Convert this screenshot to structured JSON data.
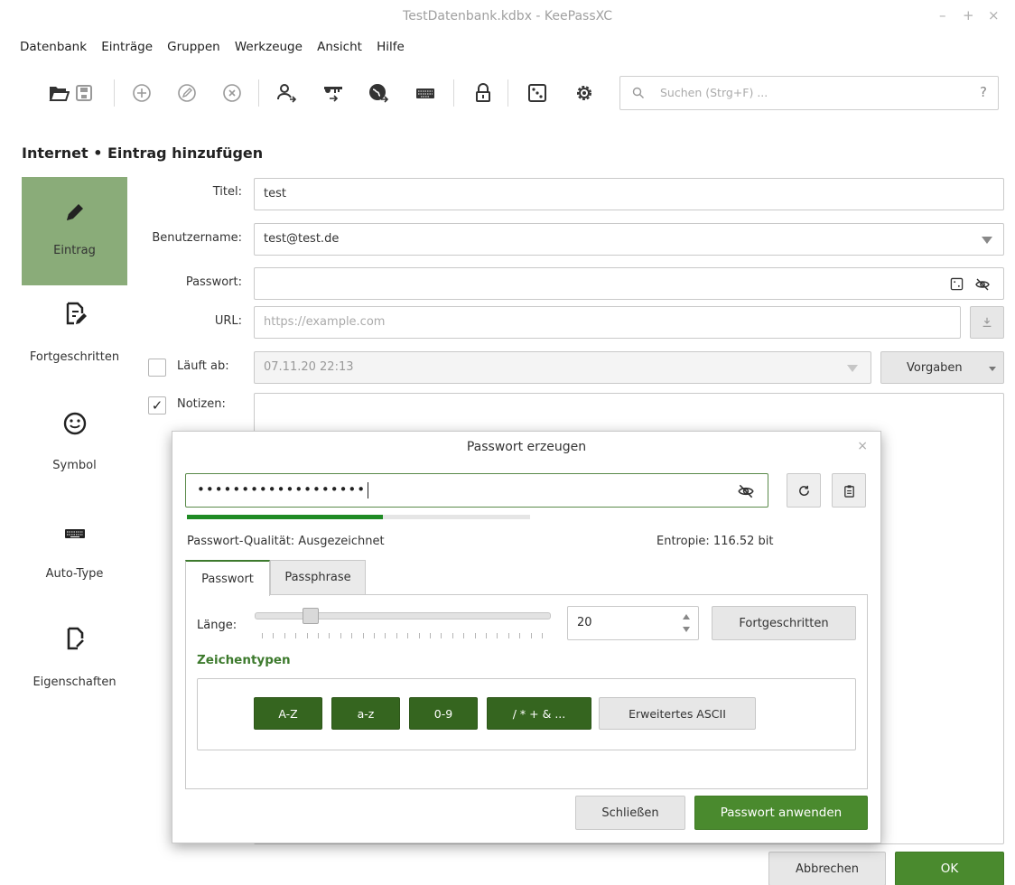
{
  "window": {
    "title": "TestDatenbank.kdbx - KeePassXC",
    "minimize": "–",
    "maximize": "+",
    "close": "×"
  },
  "menu": [
    "Datenbank",
    "Einträge",
    "Gruppen",
    "Werkzeuge",
    "Ansicht",
    "Hilfe"
  ],
  "toolbar": {
    "icons": [
      "open-database-icon",
      "save-database-icon",
      "add-entry-icon",
      "edit-entry-icon",
      "delete-entry-icon",
      "copy-username-icon",
      "copy-password-icon",
      "open-url-icon",
      "auto-type-icon",
      "lock-database-icon",
      "password-generator-icon",
      "settings-icon"
    ],
    "search_placeholder": "Suchen (Strg+F) ...",
    "search_help": "?"
  },
  "heading": "Internet • Eintrag hinzufügen",
  "sidebar": {
    "items": [
      {
        "label": "Eintrag",
        "icon": "pencil-icon",
        "active": true
      },
      {
        "label": "Fortgeschritten",
        "icon": "document-edit-icon",
        "active": false
      },
      {
        "label": "Symbol",
        "icon": "smiley-icon",
        "active": false
      },
      {
        "label": "Auto-Type",
        "icon": "keyboard-icon",
        "active": false
      },
      {
        "label": "Eigenschaften",
        "icon": "document-arrow-icon",
        "active": false
      }
    ]
  },
  "form": {
    "title_label": "Titel:",
    "title_value": "test",
    "username_label": "Benutzername:",
    "username_value": "test@test.de",
    "password_label": "Passwort:",
    "password_value": "",
    "url_label": "URL:",
    "url_placeholder": "https://example.com",
    "expires_label": "Läuft ab:",
    "expires_checked": false,
    "expires_value": "07.11.20 22:13",
    "presets_label": "Vorgaben",
    "notes_label": "Notizen:",
    "notes_checked": true,
    "notes_check_mark": "✓"
  },
  "generator": {
    "title": "Passwort erzeugen",
    "close": "×",
    "password_dots": "•••••••••••••••••••",
    "strength_fraction": 0.57,
    "quality_label": "Passwort-Qualität: Ausgezeichnet",
    "entropy_label": "Entropie: 116.52 bit",
    "tabs": [
      {
        "label": "Passwort",
        "active": true
      },
      {
        "label": "Passphrase",
        "active": false
      }
    ],
    "length_label": "Länge:",
    "length_value": "20",
    "length_slider_fraction": 0.17,
    "advanced_label": "Fortgeschritten",
    "char_types_title": "Zeichentypen",
    "char_types": [
      {
        "label": "A-Z",
        "on": true
      },
      {
        "label": "a-z",
        "on": true
      },
      {
        "label": "0-9",
        "on": true
      },
      {
        "label": "/ * + & ...",
        "on": true
      },
      {
        "label": "Erweitertes ASCII",
        "on": false
      }
    ],
    "close_button": "Schließen",
    "apply_button": "Passwort anwenden"
  },
  "footer": {
    "cancel": "Abbrechen",
    "ok": "OK"
  },
  "colors": {
    "accent_green": "#4a8a2e",
    "char_type_on": "#35651f",
    "sidebar_active": "#8aac79",
    "strength_bar": "#1f8b24"
  }
}
